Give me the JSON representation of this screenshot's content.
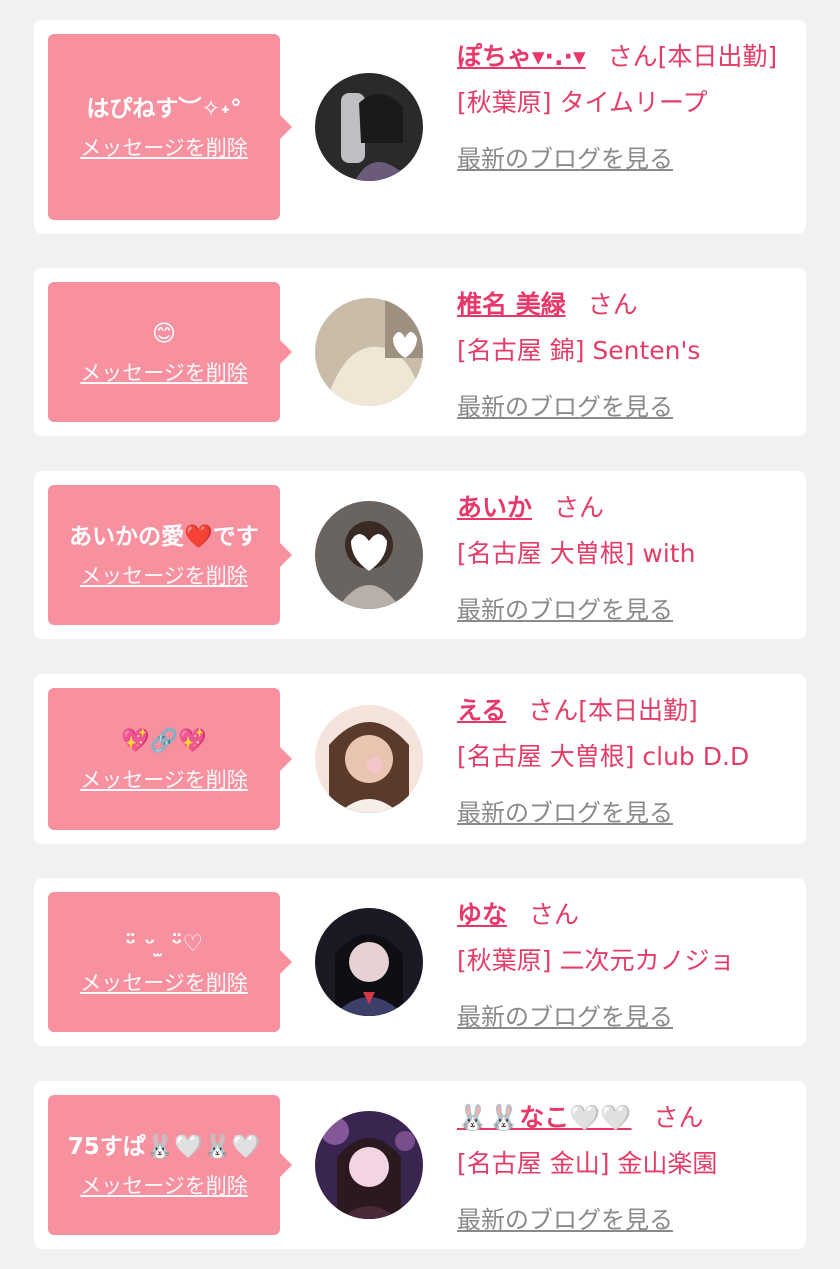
{
  "items": [
    {
      "message": "はぴねす︶✧˖°",
      "delete_label": "メッセージを削除",
      "name": "ぽちゃ▾·.·▾",
      "honorific": "さん",
      "status": "[本日出勤]",
      "shop": "[秋葉原] タイムリープ",
      "blog_label": "最新のブログを見る",
      "avatar_colors": [
        "#2a2a2a",
        "#6b5a7a",
        "#d8d8de"
      ]
    },
    {
      "message": "😊",
      "delete_label": "メッセージを削除",
      "name": "椎名 美緑",
      "honorific": "さん",
      "status": "",
      "shop": "[名古屋 錦] Senten's",
      "blog_label": "最新のブログを見る",
      "avatar_colors": [
        "#c9bca8",
        "#efe6d6",
        "#ffffff"
      ]
    },
    {
      "message": "あいかの愛❤️です",
      "delete_label": "メッセージを削除",
      "name": "あいか",
      "honorific": "さん",
      "status": "",
      "shop": "[名古屋 大曽根] with",
      "blog_label": "最新のブログを見る",
      "avatar_colors": [
        "#6a6460",
        "#b8b0a8",
        "#ffffff"
      ]
    },
    {
      "message": "💖🔗💖",
      "delete_label": "メッセージを削除",
      "name": "える",
      "honorific": "さん",
      "status": "[本日出勤]",
      "shop": "[名古屋 大曽根] club D.D",
      "blog_label": "最新のブログを見る",
      "avatar_colors": [
        "#5a3a2a",
        "#e9c4b0",
        "#f4e4dc"
      ]
    },
    {
      "message": "ᵕ̈ ᵕ ̫ ᵕ̈♡",
      "delete_label": "メッセージを削除",
      "name": "ゆな",
      "honorific": "さん",
      "status": "",
      "shop": "[秋葉原] 二次元カノジョ",
      "blog_label": "最新のブログを見る",
      "avatar_colors": [
        "#1a1a24",
        "#3b3f6a",
        "#e6d2d2"
      ]
    },
    {
      "message": "75すぱ🐰🤍🐰🤍",
      "delete_label": "メッセージを削除",
      "name": "🐰🐰なこ🤍🤍",
      "honorific": "さん",
      "status": "",
      "shop": "[名古屋 金山] 金山楽園",
      "blog_label": "最新のブログを見る",
      "avatar_colors": [
        "#3a2450",
        "#b878c8",
        "#f2d4e2"
      ]
    }
  ]
}
